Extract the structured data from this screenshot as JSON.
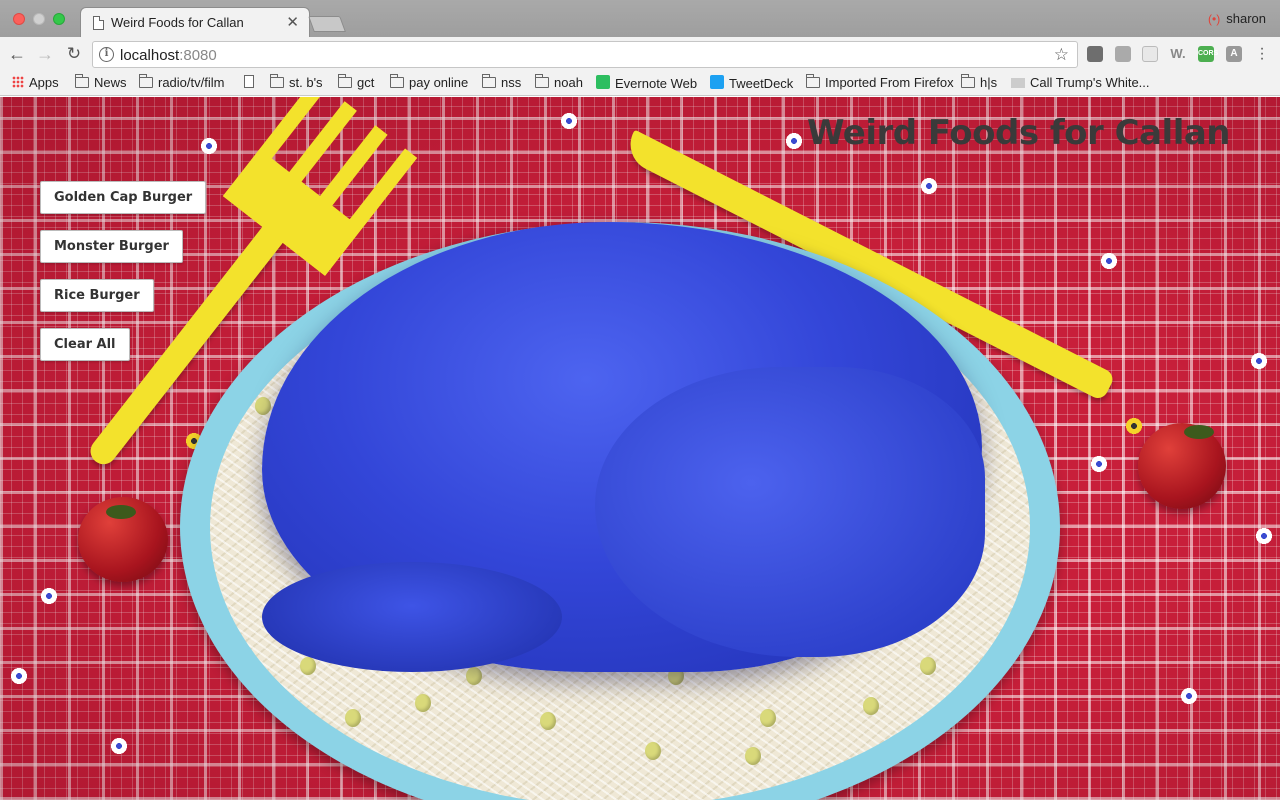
{
  "browser": {
    "tab_title": "Weird Foods for Callan",
    "tab_close": "✕",
    "profile_name": "sharon",
    "url_host": "localhost",
    "url_port": ":8080",
    "bookmarks": [
      {
        "label": "Apps",
        "icon": "apps-icon"
      },
      {
        "label": "News",
        "icon": "folder-icon"
      },
      {
        "label": "radio/tv/film",
        "icon": "folder-icon"
      },
      {
        "label": "",
        "icon": "document-icon"
      },
      {
        "label": "st. b's",
        "icon": "folder-icon"
      },
      {
        "label": "gct",
        "icon": "folder-icon"
      },
      {
        "label": "pay online",
        "icon": "folder-icon"
      },
      {
        "label": "nss",
        "icon": "folder-icon"
      },
      {
        "label": "noah",
        "icon": "folder-icon"
      },
      {
        "label": "Evernote Web",
        "icon": "evernote-icon"
      },
      {
        "label": "TweetDeck",
        "icon": "tweetdeck-icon"
      },
      {
        "label": "Imported From Firefox",
        "icon": "folder-icon"
      },
      {
        "label": "h|s",
        "icon": "folder-icon"
      },
      {
        "label": "Call Trump's White...",
        "icon": "site-icon"
      }
    ],
    "extensions": [
      "evernote-ext-icon",
      "reader-ext-icon",
      "blank-ext-icon",
      "w-ext-icon",
      "cors-ext-icon",
      "angular-ext-icon"
    ],
    "ext_labels": {
      "w": "W.",
      "cors": "CORS",
      "angular": "A"
    }
  },
  "page": {
    "title": "Weird Foods for Callan",
    "buttons": [
      "Golden Cap Burger",
      "Monster Burger",
      "Rice Burger",
      "Clear All"
    ]
  },
  "colors": {
    "tablecloth": "#c81f3a",
    "chicken": "#3346d8",
    "utensils": "#f3e22c",
    "plate": "#8cd3e6"
  }
}
